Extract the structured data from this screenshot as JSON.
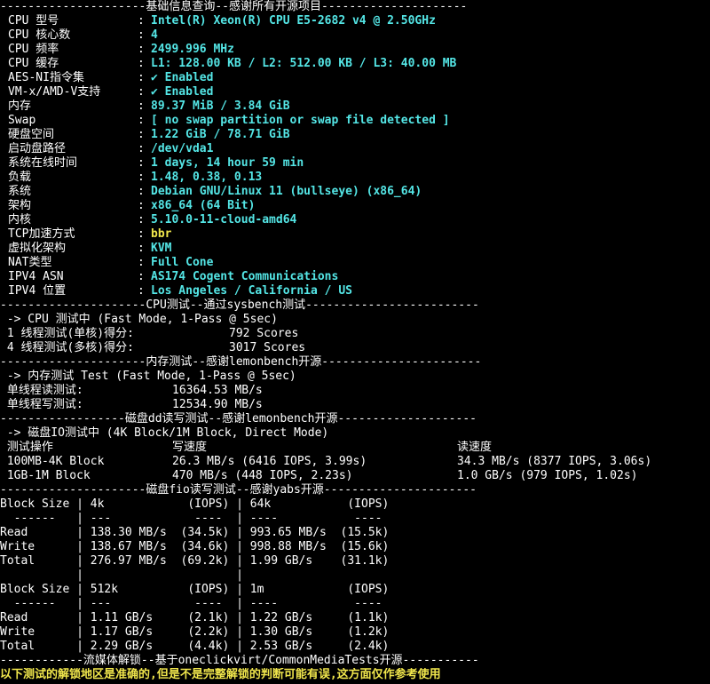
{
  "sections": {
    "basic": "---------------------基础信息查询--感谢所有开源项目---------------------",
    "cpu": "---------------------CPU测试--通过sysbench测试-------------------------",
    "mem": "---------------------内存测试--感谢lemonbench开源-----------------------",
    "dd": "------------------磁盘dd读写测试--感谢lemonbench开源--------------------",
    "fio": "---------------------磁盘fio读写测试--感谢yabs开源----------------------",
    "media": "------------流媒体解锁--基于oneclickvirt/CommonMediaTests开源-----------"
  },
  "sysinfo": [
    {
      "key": "CPU 型号",
      "value": "Intel(R) Xeon(R) CPU E5-2682 v4 @ 2.50GHz"
    },
    {
      "key": "CPU 核心数",
      "value": "4"
    },
    {
      "key": "CPU 频率",
      "value": "2499.996 MHz"
    },
    {
      "key": "CPU 缓存",
      "value": "L1: 128.00 KB / L2: 512.00 KB / L3: 40.00 MB"
    },
    {
      "key": "AES-NI指令集",
      "value": "✔ Enabled"
    },
    {
      "key": "VM-x/AMD-V支持",
      "value": "✔ Enabled"
    },
    {
      "key": "内存",
      "value": "89.37 MiB / 3.84 GiB"
    },
    {
      "key": "Swap",
      "value": "[ no swap partition or swap file detected ]"
    },
    {
      "key": "硬盘空间",
      "value": "1.22 GiB / 78.71 GiB"
    },
    {
      "key": "启动盘路径",
      "value": "/dev/vda1"
    },
    {
      "key": "系统在线时间",
      "value": "1 days, 14 hour 59 min"
    },
    {
      "key": "负载",
      "value": "1.48, 0.38, 0.13"
    },
    {
      "key": "系统",
      "value": "Debian GNU/Linux 11 (bullseye) (x86_64)"
    },
    {
      "key": "架构",
      "value": "x86_64 (64 Bit)"
    },
    {
      "key": "内核",
      "value": "5.10.0-11-cloud-amd64"
    },
    {
      "key": "TCP加速方式",
      "value": "bbr",
      "highlight": true
    },
    {
      "key": "虚拟化架构",
      "value": "KVM"
    },
    {
      "key": "NAT类型",
      "value": "Full Cone"
    },
    {
      "key": "IPV4 ASN",
      "value": "AS174 Cogent Communications"
    },
    {
      "key": "IPV4 位置",
      "value": "Los Angeles / California / US"
    }
  ],
  "cpu_test": {
    "header": " -> CPU 测试中 (Fast Mode, 1-Pass @ 5sec)",
    "single_label": " 1 线程测试(单核)得分:",
    "single_value": "792 Scores",
    "multi_label": " 4 线程测试(多核)得分:",
    "multi_value": "3017 Scores"
  },
  "mem_test": {
    "header": " -> 内存测试 Test (Fast Mode, 1-Pass @ 5sec)",
    "read_label": " 单线程读测试:",
    "read_value": "16364.53 MB/s",
    "write_label": " 单线程写测试:",
    "write_value": "12534.90 MB/s"
  },
  "dd_test": {
    "header": " -> 磁盘IO测试中 (4K Block/1M Block, Direct Mode)",
    "columns": [
      " 测试操作",
      "写速度",
      "读速度"
    ],
    "rows": [
      [
        " 100MB-4K Block",
        "26.3 MB/s (6416 IOPS, 3.99s)",
        "34.3 MB/s (8377 IOPS, 3.06s)"
      ],
      [
        " 1GB-1M Block",
        "470 MB/s (448 IOPS, 2.23s)",
        "1.0 GB/s (979 IOPS, 1.02s)"
      ]
    ]
  },
  "fio_lines": [
    "Block Size | 4k            (IOPS) | 64k           (IOPS)",
    "  ------   | ---            ----  | ----           ----",
    "Read       | 138.30 MB/s  (34.5k) | 993.65 MB/s  (15.5k)",
    "Write      | 138.67 MB/s  (34.6k) | 998.88 MB/s  (15.6k)",
    "Total      | 276.97 MB/s  (69.2k) | 1.99 GB/s    (31.1k)",
    "           |                      |",
    "Block Size | 512k          (IOPS) | 1m            (IOPS)",
    "  ------   | ---            ----  | ----           ----",
    "Read       | 1.11 GB/s     (2.1k) | 1.22 GB/s     (1.1k)",
    "Write      | 1.17 GB/s     (2.2k) | 1.30 GB/s     (1.2k)",
    "Total      | 2.29 GB/s     (4.4k) | 2.53 GB/s     (2.4k)"
  ],
  "warning": "以下测试的解锁地区是准确的,但是不是完整解锁的判断可能有误,这方面仅作参考使用",
  "colors": {
    "background": "#000000",
    "text": "#ffffff",
    "value": "#54e6e6",
    "highlight": "#f0e64c"
  }
}
